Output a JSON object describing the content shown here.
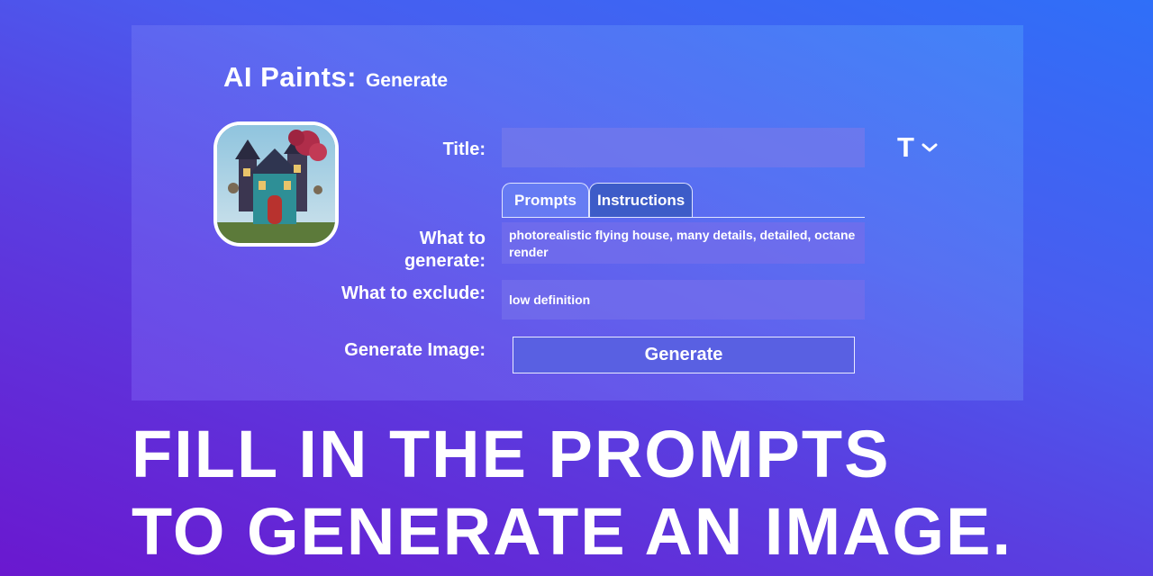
{
  "header": {
    "app_name": "AI Paints:",
    "page_title": "Generate"
  },
  "form": {
    "title_label": "Title:",
    "title_value": "",
    "tabs": [
      {
        "label": "Prompts",
        "active": true
      },
      {
        "label": "Instructions",
        "active": false
      }
    ],
    "generate_label_line1": "What to",
    "generate_label_line2": "generate:",
    "generate_value": "photorealistic flying house, many details, detailed, octane render",
    "exclude_label": "What to exclude:",
    "exclude_value": "low definition",
    "generate_image_label": "Generate Image:",
    "generate_button": "Generate"
  },
  "toolbar": {
    "text_tool_glyph": "T",
    "icons": [
      "text-tool-icon",
      "chevron-down-icon"
    ]
  },
  "headline": {
    "line1": "FILL IN THE PROMPTS",
    "line2": "TO GENERATE AN IMAGE."
  },
  "colors": {
    "background_start": "#6a18cf",
    "background_end": "#2f6ff8",
    "button": "#5960e2",
    "tab_inactive": "#3d5cc8"
  }
}
